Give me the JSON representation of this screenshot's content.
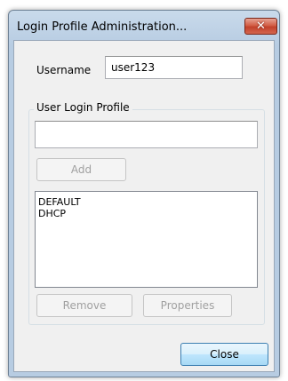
{
  "window": {
    "title": "Login Profile Administration...",
    "close_glyph": "✕"
  },
  "form": {
    "username_label": "Username",
    "username_value": "user123",
    "group_title": "User Login Profile",
    "profile_input_value": "",
    "add_label": "Add",
    "profiles": [
      "DEFAULT",
      "DHCP"
    ],
    "remove_label": "Remove",
    "properties_label": "Properties",
    "close_label": "Close"
  },
  "icons": {
    "title_close": "close-icon"
  }
}
